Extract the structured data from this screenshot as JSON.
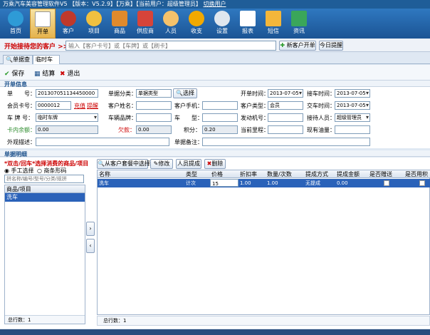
{
  "title": "万乘汽车美容管理软件V5 【版本：V5.2.9】【万乘】【当前用户：超级管理员】",
  "title_link": "切换用户",
  "toolbar": [
    "首页",
    "开单",
    "客户",
    "项目",
    "商品",
    "供应商",
    "人员",
    "收支",
    "设置",
    "报表",
    "短信",
    "资讯"
  ],
  "search": {
    "label": "开始接待您的客户 >>",
    "placeholder": "输入【客户卡号】或【车牌】或【刷卡】",
    "new_customer": "新客户开单",
    "today_reminder": "今日提醒"
  },
  "tabs": [
    "单据查询",
    "临时车牌"
  ],
  "actions": {
    "save": "保存",
    "checkout": "结算",
    "exit": "退出"
  },
  "order": {
    "section": "开单信息",
    "order_no_label": "单　　号：",
    "order_no": "201307051134450000",
    "type_label": "单据分类：",
    "type_value": "单据类型",
    "select": "选择",
    "open_time_label": "开单时间：",
    "open_time": "2013-07-05",
    "pickup_label": "接车时间：",
    "pickup_time": "2013-07-05",
    "card_label": "会员卡号：",
    "card": "0000012",
    "recharge": "充值",
    "remind": "提醒",
    "cust_name_label": "客户姓名：",
    "cust_phone_label": "客户手机：",
    "cust_type_label": "客户类型：",
    "cust_type": "会员",
    "deliver_label": "交车时间：",
    "deliver_time": "2013-07-05",
    "plate_label": "车 牌 号：",
    "plate": "临时车牌",
    "brand_label": "车辆品牌：",
    "model_label": "车　　型：",
    "engine_label": "发动机号：",
    "receiver_label": "接待人员：",
    "receiver": "超级管理员",
    "balance_label": "卡内余额：",
    "balance": "0.00",
    "owe_label": "欠款：",
    "owe": "0.00",
    "points_label": "积分：",
    "points": "0.20",
    "mileage_label": "当前里程：",
    "oil_label": "现有油量：",
    "appearance_label": "外观描述：",
    "remark_label": "单据备注："
  },
  "detail": {
    "section": "单据明细",
    "hint": "*双击/回车*选择消费的商品/项目",
    "manual": "手工选择",
    "scan": "商条形码",
    "search_placeholder": "拼名称/编号/型号/分类/规拼",
    "list_header": "商品/项目",
    "list_items": [
      "洗车"
    ],
    "left_total": "总行数：1",
    "btn_package": "从客户套餐中选择",
    "btn_edit": "修改",
    "btn_staff": "人员提成",
    "btn_delete": "删除",
    "columns": [
      "名称",
      "类型",
      "价格",
      "折扣率",
      "数量/次数",
      "提成方式",
      "提成金额",
      "是否赠送",
      "是否用积分"
    ],
    "rows": [
      [
        "洗车",
        "计次",
        "15",
        "1.00",
        "1.00",
        "无提成",
        "0.00"
      ]
    ],
    "right_total": "总行数：1"
  }
}
